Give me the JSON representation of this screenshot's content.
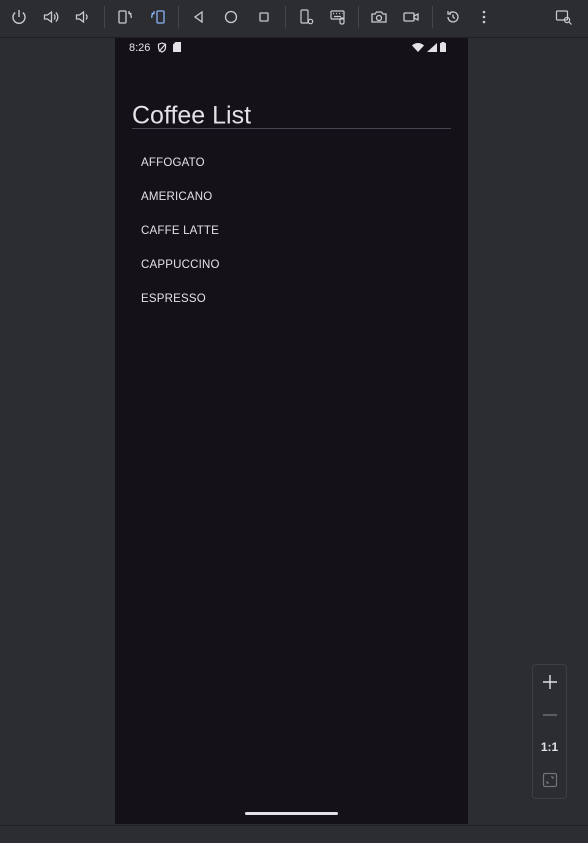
{
  "toolbar": {
    "buttons": [
      {
        "icon": "power-icon"
      },
      {
        "icon": "volume-up-icon"
      },
      {
        "icon": "volume-down-icon"
      },
      {
        "icon": "rotate-left-icon"
      },
      {
        "icon": "rotate-right-icon"
      },
      {
        "icon": "back-icon"
      },
      {
        "icon": "home-icon"
      },
      {
        "icon": "overview-icon"
      },
      {
        "icon": "device-settings-icon"
      },
      {
        "icon": "keyboard-icon"
      },
      {
        "icon": "camera-icon"
      },
      {
        "icon": "video-record-icon"
      },
      {
        "icon": "reset-icon"
      },
      {
        "icon": "more-options-icon"
      },
      {
        "icon": "window-search-icon"
      }
    ]
  },
  "device": {
    "status_bar": {
      "time": "8:26",
      "icons": [
        "shield-icon",
        "sd-card-icon",
        "wifi-icon",
        "signal-icon",
        "battery-icon"
      ]
    },
    "app": {
      "title": "Coffee List",
      "items": [
        {
          "label": "AFFOGATO"
        },
        {
          "label": "AMERICANO"
        },
        {
          "label": "CAFFE LATTE"
        },
        {
          "label": "CAPPUCCINO"
        },
        {
          "label": "ESPRESSO"
        }
      ]
    }
  },
  "zoom": {
    "ratio_label": "1:1"
  },
  "colors": {
    "ide_background": "#2b2d30",
    "device_background": "#141218",
    "text": "#e6e1e5",
    "divider": "#49454f"
  }
}
